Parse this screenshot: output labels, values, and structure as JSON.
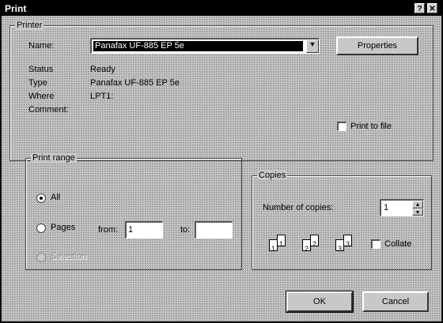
{
  "window": {
    "title": "Print",
    "help_button": "?",
    "close_button": "✕"
  },
  "printer": {
    "group_label": "Printer",
    "name_label": "Name:",
    "name_value": "Panafax UF-885 EP 5e",
    "properties_button": "Properties",
    "status_label": "Status",
    "status_value": "Ready",
    "type_label": "Type",
    "type_value": "Panafax UF-885 EP 5e",
    "where_label": "Where",
    "where_value": "LPT1:",
    "comment_label": "Comment:",
    "print_to_file_label": "Print to file",
    "print_to_file_checked": false
  },
  "print_range": {
    "group_label": "Print range",
    "all_label": "All",
    "pages_label": "Pages",
    "from_label": "from:",
    "from_value": "1",
    "to_label": "to:",
    "to_value": "",
    "selection_label": "Selection",
    "selected": "all"
  },
  "copies": {
    "group_label": "Copies",
    "number_label": "Number of copies:",
    "number_value": "1",
    "collate_label": "Collate",
    "collate_checked": false,
    "page_numbers": [
      "1",
      "1",
      "2",
      "2",
      "3",
      "3"
    ]
  },
  "buttons": {
    "ok": "OK",
    "cancel": "Cancel"
  }
}
